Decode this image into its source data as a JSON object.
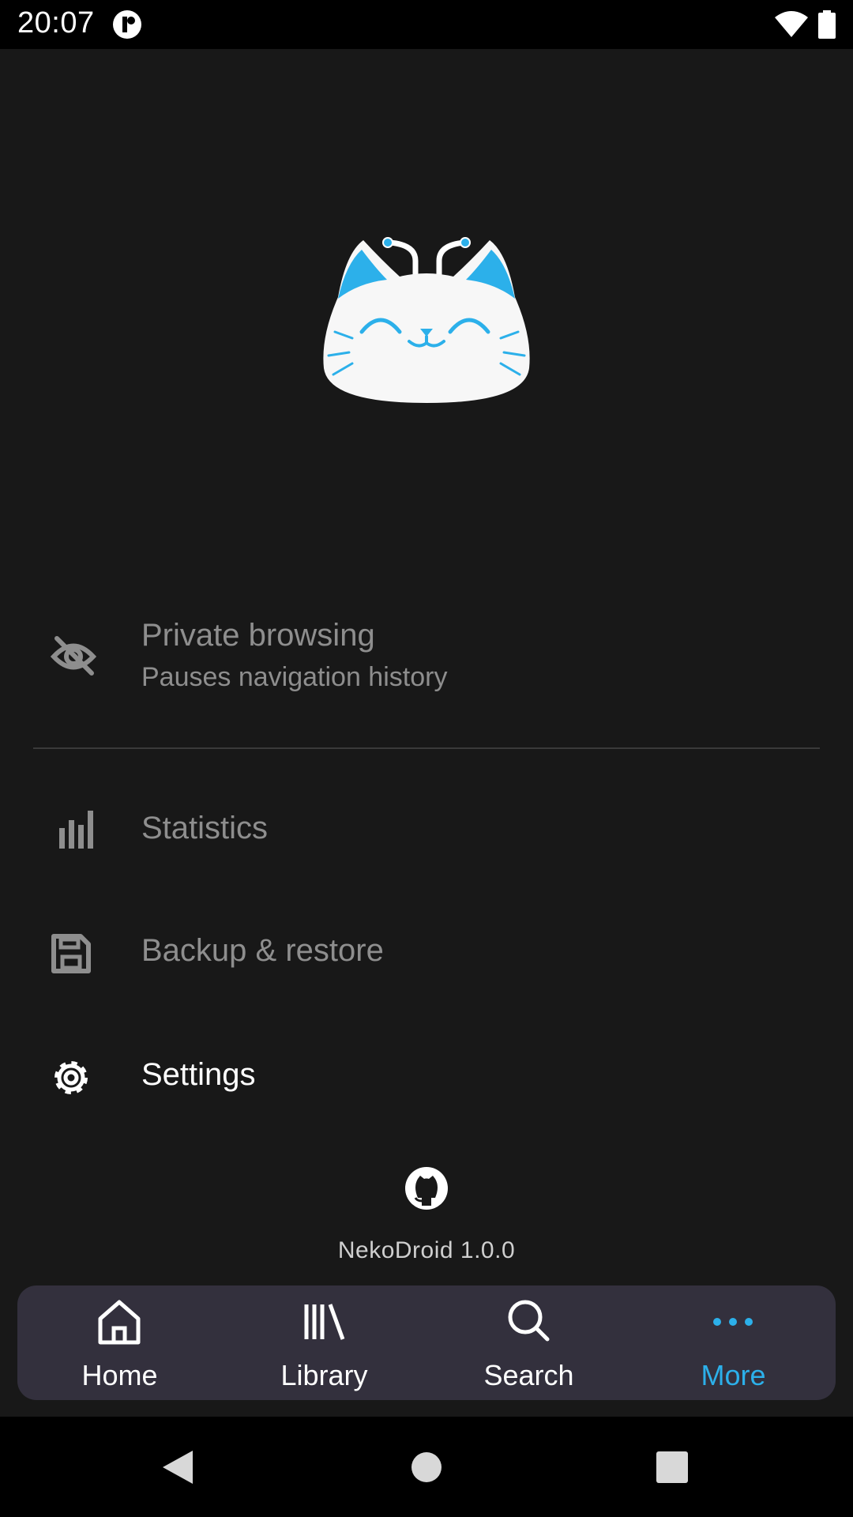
{
  "status_bar": {
    "time": "20:07"
  },
  "colors": {
    "accent": "#2cb0ea",
    "background": "#181818",
    "nav_background": "#33303d"
  },
  "menu": {
    "private_browsing": {
      "title": "Private browsing",
      "subtitle": "Pauses navigation history",
      "icon": "eye-off-icon"
    },
    "statistics": {
      "title": "Statistics",
      "icon": "bar-chart-icon"
    },
    "backup_restore": {
      "title": "Backup & restore",
      "icon": "save-icon"
    },
    "settings": {
      "title": "Settings",
      "icon": "gear-icon"
    }
  },
  "footer": {
    "version": "NekoDroid 1.0.0",
    "icon": "github-icon"
  },
  "bottom_nav": {
    "items": [
      {
        "label": "Home",
        "icon": "home-icon",
        "active": false
      },
      {
        "label": "Library",
        "icon": "library-icon",
        "active": false
      },
      {
        "label": "Search",
        "icon": "search-icon",
        "active": false
      },
      {
        "label": "More",
        "icon": "more-dots-icon",
        "active": true
      }
    ]
  }
}
